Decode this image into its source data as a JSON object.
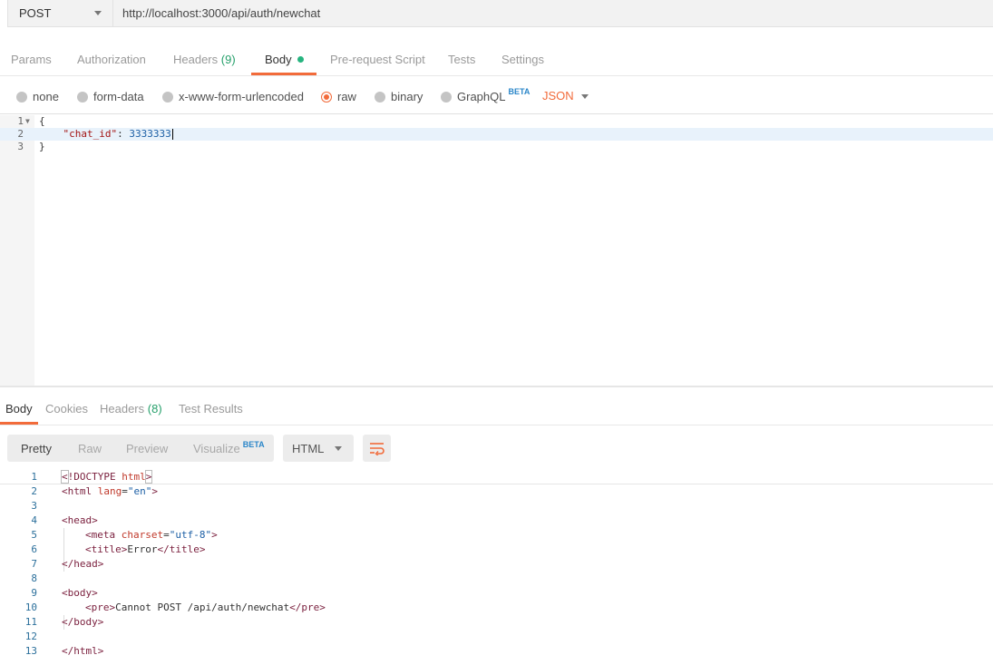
{
  "request": {
    "method": "POST",
    "url": "http://localhost:3000/api/auth/newchat"
  },
  "request_tabs": {
    "params": "Params",
    "authorization": "Authorization",
    "headers": "Headers",
    "headers_count": "(9)",
    "body": "Body",
    "pre_request": "Pre-request Script",
    "tests": "Tests",
    "settings": "Settings"
  },
  "body_types": {
    "none": "none",
    "form_data": "form-data",
    "urlencoded": "x-www-form-urlencoded",
    "raw": "raw",
    "binary": "binary",
    "graphql": "GraphQL",
    "beta": "BETA",
    "format": "JSON",
    "selected": "raw"
  },
  "request_body": {
    "lines": [
      {
        "n": "1",
        "pre": "{",
        "key": "",
        "sep": "",
        "val": ""
      },
      {
        "n": "2",
        "pre": "    ",
        "key": "\"chat_id\"",
        "sep": ": ",
        "val": "3333333"
      },
      {
        "n": "3",
        "pre": "}",
        "key": "",
        "sep": "",
        "val": ""
      }
    ]
  },
  "response_tabs": {
    "body": "Body",
    "cookies": "Cookies",
    "headers": "Headers",
    "headers_count": "(8)",
    "test_results": "Test Results"
  },
  "response_view": {
    "pretty": "Pretty",
    "raw": "Raw",
    "preview": "Preview",
    "visualize": "Visualize",
    "beta": "BETA",
    "format": "HTML"
  },
  "response_body": {
    "line_numbers": [
      "1",
      "2",
      "3",
      "4",
      "5",
      "6",
      "7",
      "8",
      "9",
      "10",
      "11",
      "12",
      "13"
    ],
    "l1_open": "<",
    "l1_doctype": "!DOCTYPE",
    "l1_html": "html",
    "l1_close": ">",
    "l2_tag": "<html",
    "l2_attr": "lang",
    "l2_eq": "=",
    "l2_val": "\"en\"",
    "l2_close": ">",
    "l4": "<head>",
    "l5_tag": "<meta",
    "l5_attr": "charset",
    "l5_eq": "=",
    "l5_val": "\"utf-8\"",
    "l5_close": ">",
    "l6_open": "<title>",
    "l6_text": "Error",
    "l6_close": "</title>",
    "l7": "</head>",
    "l9": "<body>",
    "l10_open": "<pre>",
    "l10_text": "Cannot POST /api/auth/newchat",
    "l10_close": "</pre>",
    "l11": "</body>",
    "l13": "</html>"
  },
  "colors": {
    "accent": "#f26b3a",
    "count_green": "#26a06b",
    "beta_blue": "#2a86c9"
  }
}
